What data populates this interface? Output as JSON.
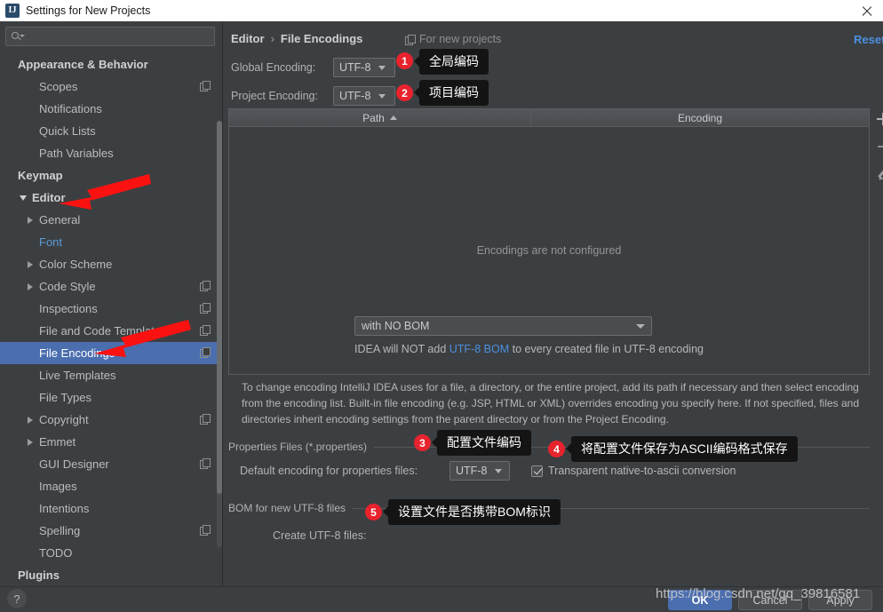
{
  "window": {
    "title": "Settings for New Projects",
    "icon": "intellij-idea-icon",
    "close_label": "×"
  },
  "sidebar": {
    "search": {
      "placeholder": "",
      "value": "",
      "icon": "search-icon"
    },
    "items": [
      {
        "label": "Appearance & Behavior",
        "indent": 0,
        "group": true,
        "twisty": "none",
        "copy": false,
        "selected": false,
        "link": false
      },
      {
        "label": "Scopes",
        "indent": 1,
        "group": false,
        "twisty": "none",
        "copy": true,
        "selected": false,
        "link": false
      },
      {
        "label": "Notifications",
        "indent": 1,
        "group": false,
        "twisty": "none",
        "copy": false,
        "selected": false,
        "link": false
      },
      {
        "label": "Quick Lists",
        "indent": 1,
        "group": false,
        "twisty": "none",
        "copy": false,
        "selected": false,
        "link": false
      },
      {
        "label": "Path Variables",
        "indent": 1,
        "group": false,
        "twisty": "none",
        "copy": false,
        "selected": false,
        "link": false
      },
      {
        "label": "Keymap",
        "indent": 0,
        "group": true,
        "twisty": "none",
        "copy": false,
        "selected": false,
        "link": false
      },
      {
        "label": "Editor",
        "indent": 0,
        "group": true,
        "twisty": "down",
        "copy": false,
        "selected": false,
        "link": false
      },
      {
        "label": "General",
        "indent": 1,
        "group": false,
        "twisty": "right",
        "copy": false,
        "selected": false,
        "link": false
      },
      {
        "label": "Font",
        "indent": 1,
        "group": false,
        "twisty": "none",
        "copy": false,
        "selected": false,
        "link": true
      },
      {
        "label": "Color Scheme",
        "indent": 1,
        "group": false,
        "twisty": "right",
        "copy": false,
        "selected": false,
        "link": false
      },
      {
        "label": "Code Style",
        "indent": 1,
        "group": false,
        "twisty": "right",
        "copy": true,
        "selected": false,
        "link": false
      },
      {
        "label": "Inspections",
        "indent": 1,
        "group": false,
        "twisty": "none",
        "copy": true,
        "selected": false,
        "link": false
      },
      {
        "label": "File and Code Templates",
        "indent": 1,
        "group": false,
        "twisty": "none",
        "copy": true,
        "selected": false,
        "link": false
      },
      {
        "label": "File Encodings",
        "indent": 1,
        "group": false,
        "twisty": "none",
        "copy": true,
        "selected": true,
        "link": false
      },
      {
        "label": "Live Templates",
        "indent": 1,
        "group": false,
        "twisty": "none",
        "copy": false,
        "selected": false,
        "link": false
      },
      {
        "label": "File Types",
        "indent": 1,
        "group": false,
        "twisty": "none",
        "copy": false,
        "selected": false,
        "link": false
      },
      {
        "label": "Copyright",
        "indent": 1,
        "group": false,
        "twisty": "right",
        "copy": true,
        "selected": false,
        "link": false
      },
      {
        "label": "Emmet",
        "indent": 1,
        "group": false,
        "twisty": "right",
        "copy": false,
        "selected": false,
        "link": false
      },
      {
        "label": "GUI Designer",
        "indent": 1,
        "group": false,
        "twisty": "none",
        "copy": true,
        "selected": false,
        "link": false
      },
      {
        "label": "Images",
        "indent": 1,
        "group": false,
        "twisty": "none",
        "copy": false,
        "selected": false,
        "link": false
      },
      {
        "label": "Intentions",
        "indent": 1,
        "group": false,
        "twisty": "none",
        "copy": false,
        "selected": false,
        "link": false
      },
      {
        "label": "Spelling",
        "indent": 1,
        "group": false,
        "twisty": "none",
        "copy": true,
        "selected": false,
        "link": false
      },
      {
        "label": "TODO",
        "indent": 1,
        "group": false,
        "twisty": "none",
        "copy": false,
        "selected": false,
        "link": false
      },
      {
        "label": "Plugins",
        "indent": 0,
        "group": true,
        "twisty": "none",
        "copy": false,
        "selected": false,
        "link": false
      }
    ]
  },
  "content": {
    "breadcrumb": {
      "parent": "Editor",
      "separator": "›",
      "current": "File Encodings"
    },
    "for_new_projects": "For new projects",
    "reset_link": "Reset",
    "global_encoding": {
      "label": "Global Encoding:",
      "value": "UTF-8"
    },
    "project_encoding": {
      "label": "Project Encoding:",
      "value": "UTF-8"
    },
    "table": {
      "columns": [
        "Path",
        "Encoding"
      ],
      "sort_column": "Path",
      "sort_direction": "ascending",
      "rows": [],
      "empty_message": "Encodings are not configured",
      "toolbar": [
        "add-icon",
        "remove-icon",
        "edit-icon"
      ]
    },
    "description": "To change encoding IntelliJ IDEA uses for a file, a directory, or the entire project, add its path if necessary and then select encoding from the encoding list. Built-in file encoding (e.g. JSP, HTML or XML) overrides encoding you specify here. If not specified, files and directories inherit encoding settings from the parent directory or from the Project Encoding.",
    "properties_section": {
      "title": "Properties Files (*.properties)",
      "default_encoding_label": "Default encoding for properties files:",
      "default_encoding_value": "UTF-8",
      "transparent_label": "Transparent native-to-ascii conversion",
      "transparent_checked": true
    },
    "bom_section": {
      "title": "BOM for new UTF-8 files",
      "create_label": "Create UTF-8 files:",
      "create_value": "with NO BOM",
      "note_prefix": "IDEA will NOT add ",
      "note_highlight": "UTF-8 BOM",
      "note_suffix": " to every created file in UTF-8 encoding"
    }
  },
  "annotations": {
    "badge_color": "#e8232e",
    "tooltip_bg": "#141414",
    "markers": [
      {
        "number": "1",
        "text": "全局编码"
      },
      {
        "number": "2",
        "text": "项目编码"
      },
      {
        "number": "3",
        "text": "配置文件编码"
      },
      {
        "number": "4",
        "text": "将配置文件保存为ASCII编码格式保存"
      },
      {
        "number": "5",
        "text": "设置文件是否携带BOM标识"
      }
    ],
    "arrow_color": "#fc1111"
  },
  "footer": {
    "help_label": "?",
    "ok_label": "OK",
    "cancel_label": "Cancel",
    "apply_label": "Apply",
    "watermark": "https://blog.csdn.net/qq_39816581"
  },
  "theme": {
    "background": "#3c3f41",
    "selection": "#4b6eaf",
    "link": "#4b8fe0",
    "text": "#bbbbbb"
  }
}
